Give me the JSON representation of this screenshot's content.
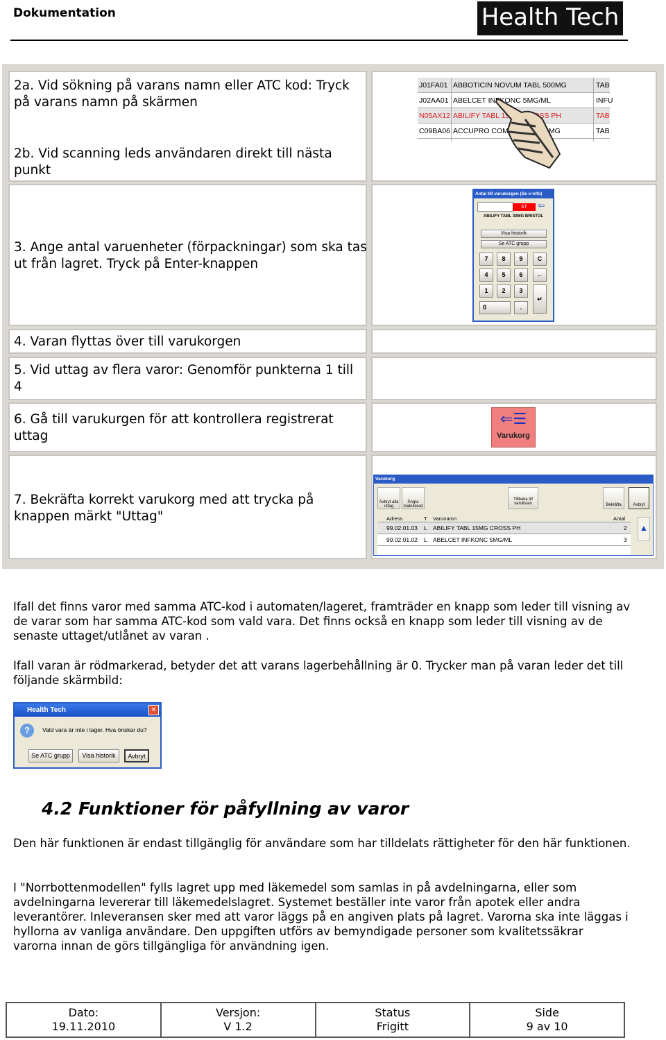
{
  "header": {
    "title": "Dokumentation",
    "logo_text": "Health Tech"
  },
  "steps": [
    {
      "text_a": "2a. Vid sökning på varans namn eller ATC kod: Tryck på varans namn på skärmen",
      "text_b": "2b. Vid scanning leds användaren direkt till nästa punkt"
    },
    {
      "text": "3. Ange antal varuenheter (förpackningar) som ska tas ut från lagret. Tryck på Enter-knappen"
    },
    {
      "text": "4. Varan flyttas över till varukorgen"
    },
    {
      "text": "5. Vid uttag av flera varor: Genomför punkterna 1 till 4"
    },
    {
      "text": "6. Gå till varukurgen för att kontrollera registrerat uttag"
    },
    {
      "text": "7. Bekräfta korrekt varukorg med att trycka på knappen märkt \"Uttag\""
    }
  ],
  "product_list": {
    "rows": [
      {
        "atc": "J01FA01",
        "name": "ABBOTICIN NOVUM TABL 500MG",
        "form": "TAB",
        "red": false
      },
      {
        "atc": "J02AA01",
        "name": "ABELCET INFKONC 5MG/ML",
        "form": "INFU",
        "red": false
      },
      {
        "atc": "N05AX12",
        "name": "ABILIFY TABL 15MG CROSS PH",
        "form": "TAB",
        "red": true
      },
      {
        "atc": "C09BA06",
        "name": "ACCUPRO COMP TABL 12.5MG",
        "form": "TAB",
        "red": false
      }
    ],
    "cursor_icon": "pointing-hand-icon"
  },
  "keypad": {
    "title": "Antal till varukorgen (Se v-info)",
    "unit": "ST",
    "product": "ABILIFY TABL 30MG BRISTOL",
    "btn_history": "Visa historik",
    "btn_atc": "Se ATC grupp",
    "keys": [
      "7",
      "8",
      "9",
      "C",
      "4",
      "5",
      "6",
      "←",
      "1",
      "2",
      "3",
      "↵",
      "0",
      "."
    ]
  },
  "varukorg_button": {
    "label": "Varukorg",
    "color": "#f08080"
  },
  "varukorg": {
    "title": "Varukorg",
    "toolbar": [
      "Avbryt alla uttag",
      "Ångra makulerad",
      "Tillbaka till varulistan",
      "Bekräfta",
      "Avbryt"
    ],
    "columns": [
      "Adress",
      "T",
      "Varunamn",
      "Antal"
    ],
    "rows": [
      {
        "adress": "99.02.01.03",
        "t": "L",
        "name": "ABILIFY TABL 15MG CROSS PH",
        "antal": "2"
      },
      {
        "adress": "99.02.01.02",
        "t": "L",
        "name": "ABELCET INFKONC 5MG/ML",
        "antal": "3"
      }
    ]
  },
  "para1": "Ifall det finns varor med samma ATC-kod i automaten/lageret, framträder en knapp som leder till visning av de varar som har samma ATC-kod som vald vara. Det finns också en knapp som leder till visning av de senaste uttaget/utlånet av varan .",
  "para2": "Ifall varan är rödmarkerad, betyder det att varans lagerbehållning är 0. Trycker man på varan leder det till följande skärmbild:",
  "dialog": {
    "title": "Health Tech",
    "message": "Vald vara är inte i lager. Hva önskar du?",
    "buttons": [
      "Se ATC grupp",
      "Visa historik",
      "Avbryt"
    ]
  },
  "section": {
    "heading": "4.2  Funktioner för påfyllning av varor",
    "para1": "Den här funktionen är endast tillgänglig för användare som har tilldelats rättigheter för den här funktionen.",
    "para2": "I \"Norrbottenmodellen\" fylls lagret upp med läkemedel som samlas in på avdelningarna, eller som avdelningarna levererar till läkemedelslagret. Systemet beställer inte varor från apotek eller andra leverantörer. Inleveransen sker med att varor läggs på en angiven plats på lagret. Varorna ska inte läggas i hyllorna av vanliga användare. Den uppgiften utförs av bemyndigade personer som kvalitetssäkrar varorna innan de görs tillgängliga för användning igen."
  },
  "footer": {
    "labels": [
      "Dato:",
      "Versjon:",
      "Status",
      "Side"
    ],
    "values": [
      "19.11.2010",
      "V 1.2",
      "Frigitt",
      "9 av 10"
    ]
  }
}
